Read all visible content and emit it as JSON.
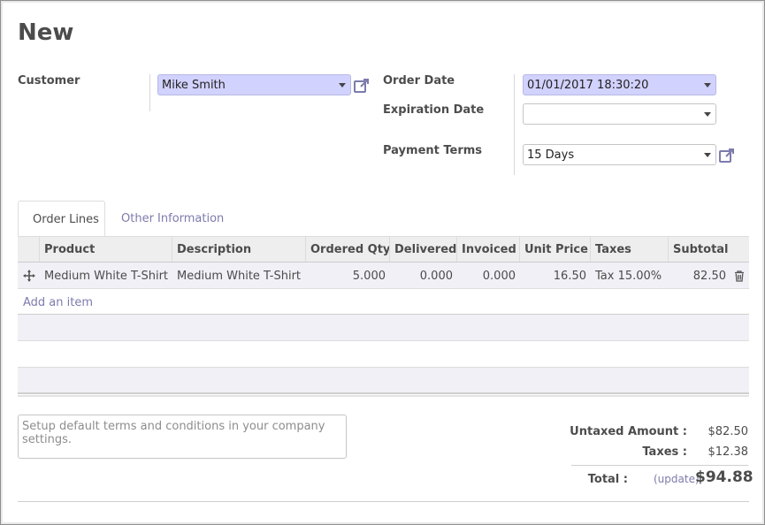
{
  "form": {
    "title": "New"
  },
  "customer": {
    "label": "Customer",
    "value": "Mike Smith"
  },
  "order_date": {
    "label": "Order Date",
    "value": "01/01/2017 18:30:20"
  },
  "expiration_date": {
    "label": "Expiration Date",
    "value": ""
  },
  "payment_terms": {
    "label": "Payment Terms",
    "value": "15 Days"
  },
  "tabs": [
    {
      "label": "Order Lines",
      "active": true
    },
    {
      "label": "Other Information",
      "active": false
    }
  ],
  "table": {
    "columns": [
      "Product",
      "Description",
      "Ordered Qty",
      "Delivered",
      "Invoiced",
      "Unit Price",
      "Taxes",
      "Subtotal"
    ],
    "rows": [
      {
        "product": "Medium White T-Shirt",
        "description": "Medium White T-Shirt",
        "ordered_qty": "5.000",
        "delivered": "0.000",
        "invoiced": "0.000",
        "unit_price": "16.50",
        "taxes": "Tax 15.00%",
        "subtotal": "82.50"
      }
    ],
    "add_item_label": "Add an item"
  },
  "notes": {
    "placeholder": "Setup default terms and conditions in your company settings."
  },
  "totals": {
    "untaxed_label": "Untaxed Amount :",
    "untaxed_value": "$82.50",
    "taxes_label": "Taxes :",
    "taxes_value": "$12.38",
    "total_label": "Total :",
    "update_label": "(update)",
    "total_value": "$94.88"
  },
  "colors": {
    "accent": "#7c7bad",
    "required_field": "#d2d2ff",
    "row_highlight": "#f0f0f6"
  },
  "icons": [
    "external-link-icon",
    "drag-handle-icon",
    "trash-icon",
    "dropdown-caret-icon"
  ]
}
